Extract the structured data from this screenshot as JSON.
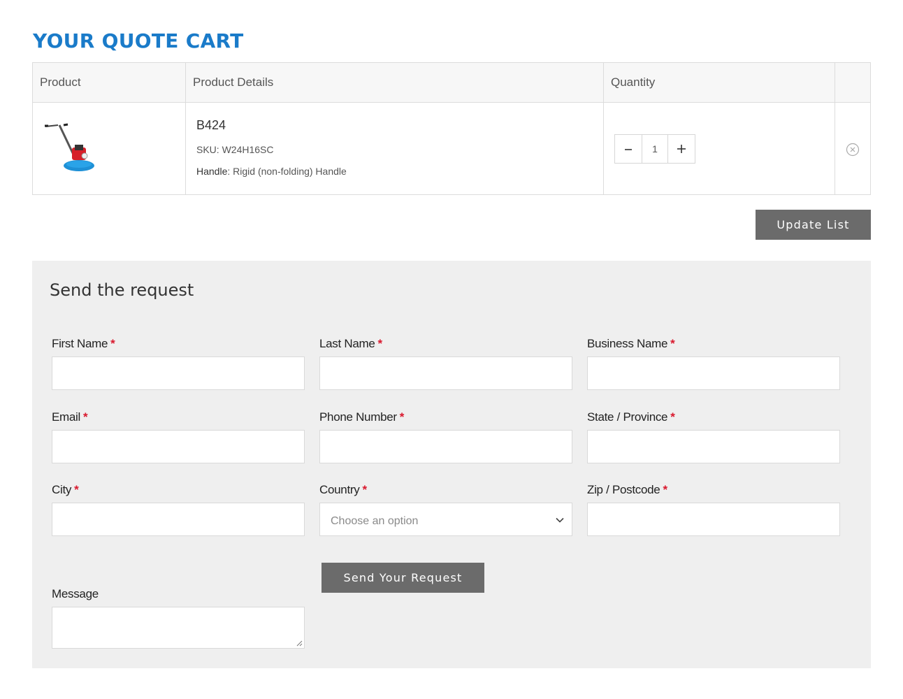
{
  "page": {
    "title": "YOUR QUOTE CART"
  },
  "cart": {
    "headers": {
      "product": "Product",
      "details": "Product Details",
      "quantity": "Quantity"
    },
    "item": {
      "name": "B424",
      "sku": "SKU: W24H16SC",
      "attr_label": "Handle",
      "attr_value": ": Rigid (non-folding) Handle",
      "quantity": "1",
      "thumb_icon": "power-trowel-icon"
    },
    "update_label": "Update List"
  },
  "form": {
    "title": "Send the request",
    "required_mark": "*",
    "fields": {
      "first_name": "First Name",
      "last_name": "Last Name",
      "business_name": "Business Name",
      "email": "Email",
      "phone": "Phone Number",
      "state": "State / Province",
      "city": "City",
      "country": "Country",
      "zip": "Zip / Postcode",
      "message": "Message"
    },
    "country_placeholder": "Choose an option",
    "submit_label": "Send Your Request"
  },
  "colors": {
    "accent": "#1a7bc9",
    "button": "#6b6b6b",
    "required": "#d9182d",
    "panel": "#efefef"
  }
}
